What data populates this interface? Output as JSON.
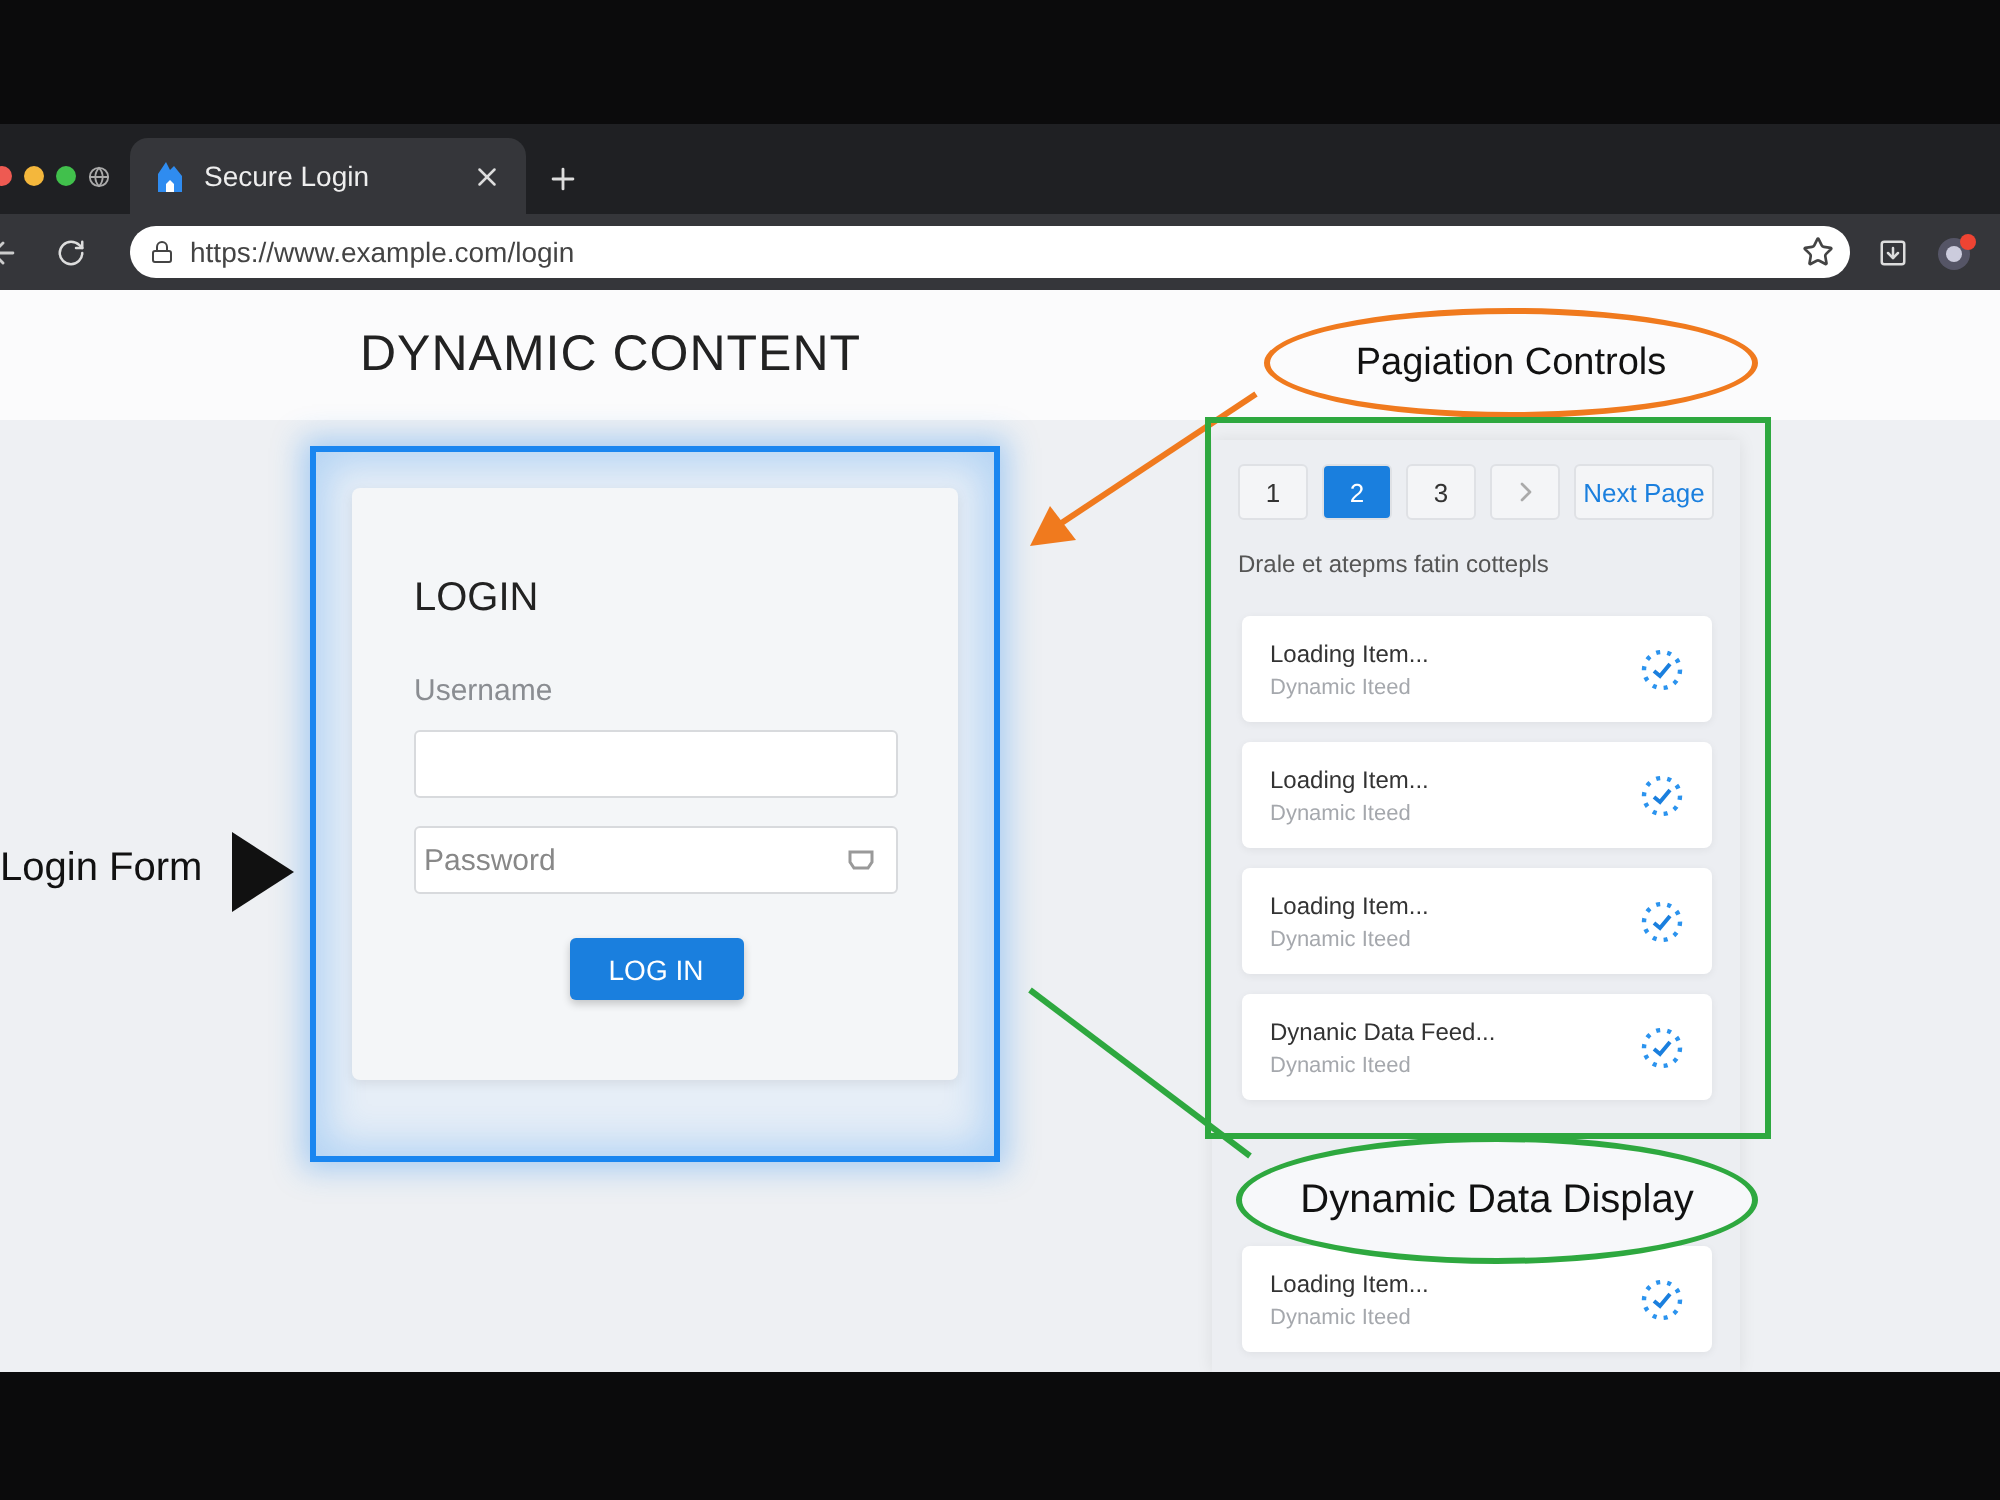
{
  "browser": {
    "tab_title": "Secure Login",
    "url": "https://www.example.com/login"
  },
  "page": {
    "title": "DYNAMIC CONTENT",
    "login": {
      "heading": "LOGIN",
      "username_label": "Username",
      "password_placeholder": "Password",
      "button": "LOG IN"
    },
    "pagination": {
      "pages": [
        {
          "label": "1",
          "selected": false
        },
        {
          "label": "2",
          "selected": true
        },
        {
          "label": "3",
          "selected": false
        }
      ],
      "next_label": "Next Page"
    },
    "feed_caption": "Drale et atepms fatin cottepls",
    "items": [
      {
        "title": "Loading Item...",
        "subtitle": "Dynamic Iteed"
      },
      {
        "title": "Loading Item...",
        "subtitle": "Dynamic Iteed"
      },
      {
        "title": "Loading Item...",
        "subtitle": "Dynamic Iteed"
      },
      {
        "title": "Dynanic Data Feed...",
        "subtitle": "Dynamic Iteed"
      },
      {
        "title": "Loading Item...",
        "subtitle": "Dynamic Iteed"
      }
    ]
  },
  "annotations": {
    "pagination_callout": {
      "label": "Pagiation Controls",
      "color": "#f07a1e"
    },
    "data_callout": {
      "label": "Dynamic Data Display",
      "color": "#2ea83f"
    },
    "login_callout": {
      "label": "Login Form"
    }
  }
}
